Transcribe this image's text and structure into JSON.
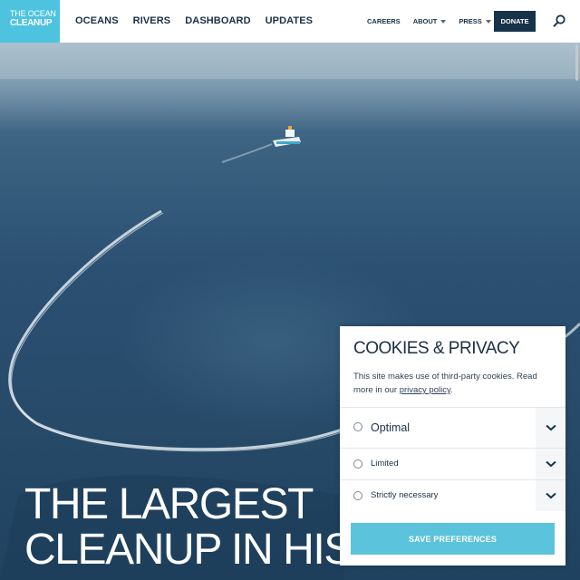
{
  "logo": {
    "line1": "THE OCEAN",
    "line2": "CLEANUP"
  },
  "main_nav": [
    "OCEANS",
    "RIVERS",
    "DASHBOARD",
    "UPDATES"
  ],
  "secondary_nav": [
    {
      "label": "CAREERS",
      "dropdown": false
    },
    {
      "label": "ABOUT",
      "dropdown": true
    },
    {
      "label": "PRESS",
      "dropdown": true
    }
  ],
  "donate_label": "DONATE",
  "search_icon": "search-icon",
  "hero": {
    "title_line1": "THE LARGEST",
    "title_line2": "CLEANUP IN HIS"
  },
  "cookie_panel": {
    "title": "COOKIES & PRIVACY",
    "text_before_link": "This site makes use of third-party cookies. Read more in our ",
    "link_text": "privacy policy",
    "text_after_link": ".",
    "options": [
      {
        "label": "Optimal",
        "selected": false,
        "icon": "chevron-down-icon"
      },
      {
        "label": "Limited",
        "selected": false,
        "icon": "chevron-down-icon"
      },
      {
        "label": "Strictly necessary",
        "selected": false,
        "icon": "chevron-down-icon"
      }
    ],
    "save_label": "SAVE PREFERENCES"
  },
  "colors": {
    "brand_cyan": "#4dc3df",
    "navy": "#17324b",
    "button_cyan": "#5bc3db"
  }
}
